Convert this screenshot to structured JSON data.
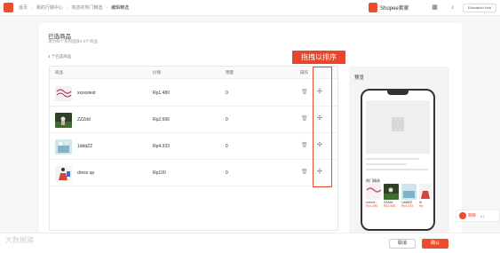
{
  "breadcrumb": [
    "首页",
    "我的行销中心",
    "商店的热门精选",
    "编辑精选"
  ],
  "brand": "Shopee卖家",
  "user_label": "Education Hub",
  "section": {
    "title": "已选商品",
    "subtitle": "请为每个系列选择4-8个商品",
    "count_text": "4 个已选商品"
  },
  "table": {
    "headers": [
      "商品",
      "价钱",
      "销量",
      "操作"
    ],
    "rows": [
      {
        "name": "xxxxxtest",
        "price": "Rp1.480",
        "sales": "0"
      },
      {
        "name": "ZZZdd",
        "price": "Rp2.666",
        "sales": "0"
      },
      {
        "name": "1dddZZ",
        "price": "Rp4.333",
        "sales": "0"
      },
      {
        "name": "dress up",
        "price": "Rp100",
        "sales": "0"
      }
    ]
  },
  "annotation": "拖拽以排序",
  "preview": {
    "title": "预览",
    "section_label": "热门精选",
    "items": [
      {
        "name": "xxxxxt...",
        "price": "Rp1.480"
      },
      {
        "name": "ZZZdd",
        "price": "Rp2.666"
      },
      {
        "name": "1dddZZ",
        "price": "Rp4.333"
      },
      {
        "name": "dr",
        "price": "Rp"
      }
    ]
  },
  "buttons": {
    "cancel": "取消",
    "confirm": "确认"
  },
  "chat": {
    "label": "聊聊",
    "badge": "61"
  },
  "watermark": "大数据猪",
  "colors": {
    "accent": "#ee4d2d",
    "highlight": "#e44d2d"
  }
}
